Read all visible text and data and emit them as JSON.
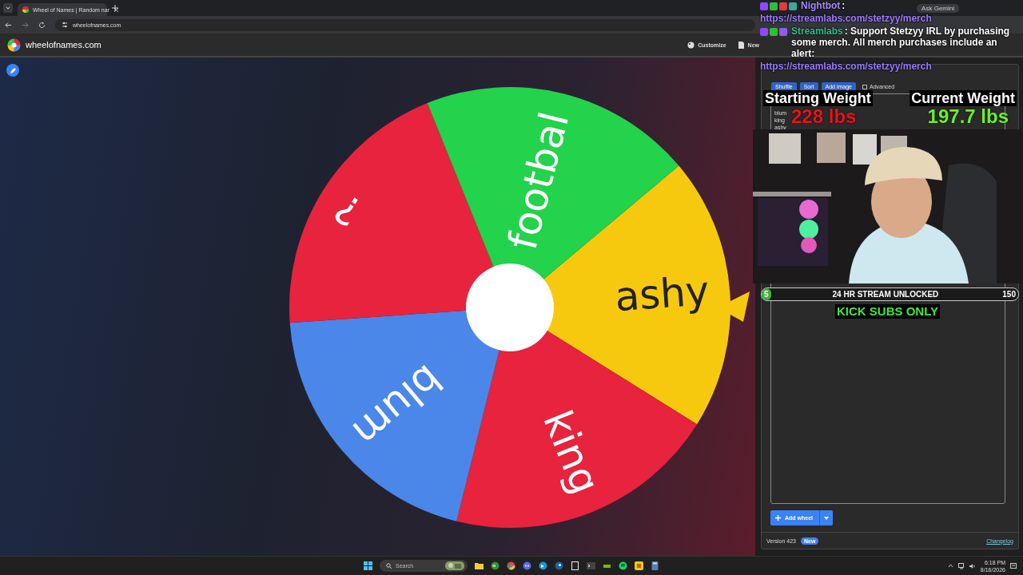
{
  "browser": {
    "tabs": [
      {
        "title": "Wheel of Names | Random nar",
        "selected": true
      }
    ],
    "address": "wheelofnames.com",
    "gemini": "Ask Gemini"
  },
  "site": {
    "title": "wheelofnames.com",
    "menu": [
      {
        "label": "Customize",
        "kind": "palette"
      },
      {
        "label": "New",
        "kind": "file"
      }
    ]
  },
  "wheel": {
    "segments": [
      {
        "label": "ashy",
        "color": "#f6c90e"
      },
      {
        "label": "king",
        "color": "#e8233d"
      },
      {
        "label": "blum",
        "color": "#4a87e8"
      },
      {
        "label": "?",
        "color": "#e8233d"
      },
      {
        "label": "footbal",
        "color": "#22d34b"
      }
    ]
  },
  "entries": {
    "toolbar": [
      {
        "label": "Shuffle"
      },
      {
        "label": "Sort"
      },
      {
        "label": "Add image"
      }
    ],
    "advanced": {
      "label": "Advanced",
      "checked": false
    },
    "items": [
      "blum",
      "king",
      "ashy"
    ],
    "add_wheel": "Add wheel",
    "version": "Version 423",
    "badge": "New",
    "changelog": "Changelog"
  },
  "overlay": {
    "chat": [
      {
        "user": "Nightbot",
        "color": "#a98bff",
        "text": ":",
        "link": "https://streamlabs.com/stetzyy/merch"
      },
      {
        "user": "Streamlabs",
        "color": "#2fc28a",
        "text": ": Support Stetzyy IRL by purchasing some merch. All merch purchases include an alert:",
        "link": "https://streamlabs.com/stetzyy/merch"
      }
    ],
    "starting_weight": {
      "label": "Starting Weight",
      "value": "228 lbs"
    },
    "current_weight": {
      "label": "Current Weight",
      "value": "197.7 lbs"
    },
    "goal": {
      "start": "5",
      "label": "24 HR STREAM UNLOCKED",
      "end": "150",
      "level": 0.033
    },
    "banner": "KICK SUBS ONLY"
  },
  "taskbar": {
    "search": "Search",
    "time": "6:18 PM",
    "date": "8/16/2026"
  }
}
